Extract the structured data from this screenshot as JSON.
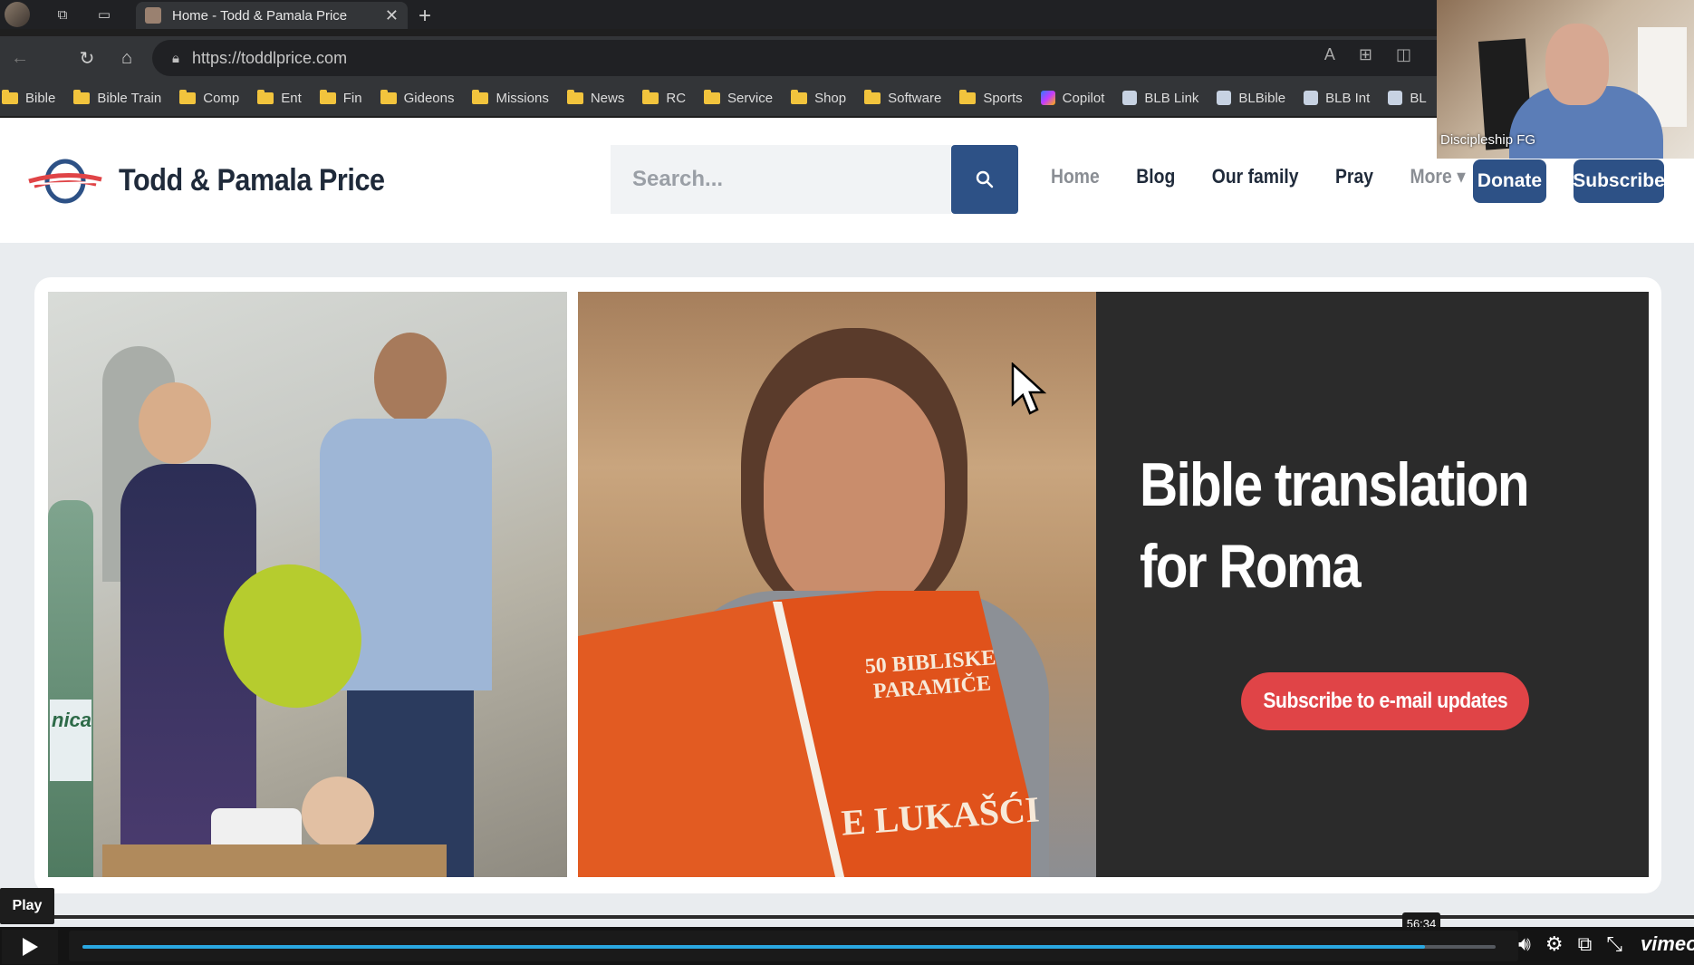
{
  "browser": {
    "tab_title": "Home - Todd & Pamala Price",
    "url": "https://toddlprice.com",
    "bookmarks": [
      {
        "label": "Bible",
        "icon": "folder-icon"
      },
      {
        "label": "Bible Train",
        "icon": "folder-icon"
      },
      {
        "label": "Comp",
        "icon": "folder-icon"
      },
      {
        "label": "Ent",
        "icon": "folder-icon"
      },
      {
        "label": "Fin",
        "icon": "folder-icon"
      },
      {
        "label": "Gideons",
        "icon": "folder-icon"
      },
      {
        "label": "Missions",
        "icon": "folder-icon"
      },
      {
        "label": "News",
        "icon": "folder-icon"
      },
      {
        "label": "RC",
        "icon": "folder-icon"
      },
      {
        "label": "Service",
        "icon": "folder-icon"
      },
      {
        "label": "Shop",
        "icon": "folder-icon"
      },
      {
        "label": "Software",
        "icon": "folder-icon"
      },
      {
        "label": "Sports",
        "icon": "folder-icon"
      },
      {
        "label": "Copilot",
        "icon": "copilot-icon"
      },
      {
        "label": "BLB Link",
        "icon": "blb-icon"
      },
      {
        "label": "BLBible",
        "icon": "blb-icon"
      },
      {
        "label": "BLB Int",
        "icon": "blb-icon"
      },
      {
        "label": "BL",
        "icon": "blb-icon"
      }
    ]
  },
  "site": {
    "title": "Todd & Pamala Price",
    "search_placeholder": "Search...",
    "nav": {
      "home": "Home",
      "blog": "Blog",
      "our_family": "Our family",
      "pray": "Pray",
      "more": "More ▾"
    },
    "donate": "Donate",
    "subscribe": "Subscribe",
    "brand_colors": {
      "primary": "#2d5186",
      "accent": "#e04447"
    }
  },
  "hero": {
    "headline": "Bible translation for Roma",
    "cta": "Subscribe to e-mail updates",
    "book_title_line1": "50 BIBLISKE",
    "book_title_line2": "PARAMIČE",
    "book_title_line3": "E LUKAŠĆI",
    "bottle_text": "nica"
  },
  "webcam": {
    "label": "Discipleship FG"
  },
  "player": {
    "tooltip": "Play",
    "time": "56:34",
    "progress": 0.95,
    "brand": "vimeo"
  }
}
